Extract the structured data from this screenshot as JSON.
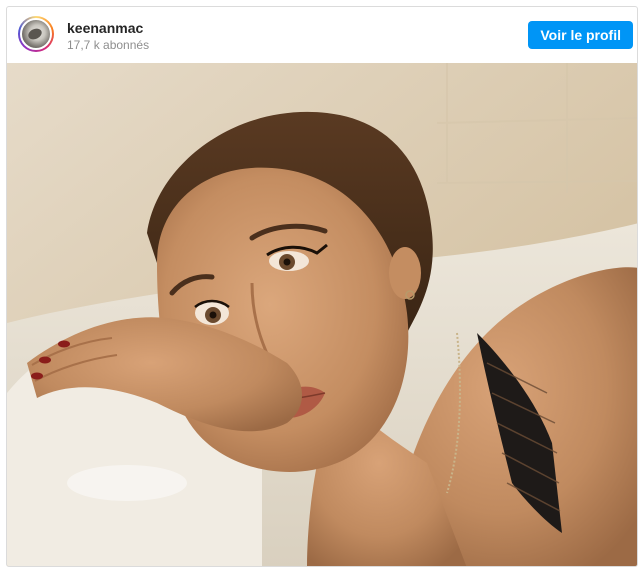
{
  "post": {
    "username": "keenanmac",
    "followers": "17,7 k abonnés",
    "view_profile_label": "Voir le profil",
    "avatar_icon": "profile-avatar",
    "photo": "post-photo"
  },
  "colors": {
    "button_blue": "#0095f6",
    "username_text": "#262626",
    "muted_text": "#8e8e8e",
    "border": "#dbdbdb"
  }
}
